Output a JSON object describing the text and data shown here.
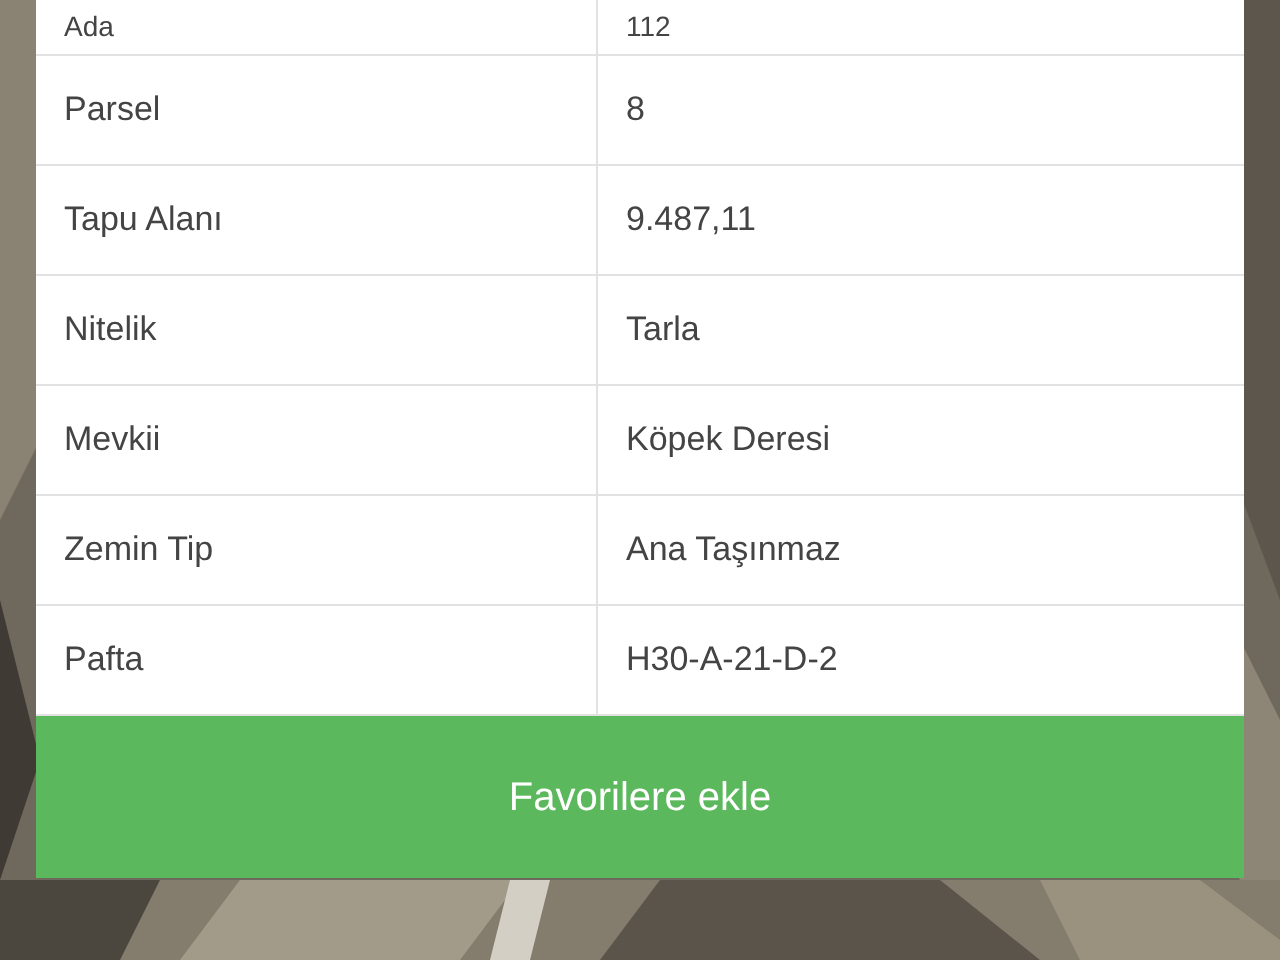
{
  "details": {
    "rows": [
      {
        "label": "Ada",
        "value": "112"
      },
      {
        "label": "Parsel",
        "value": "8"
      },
      {
        "label": "Tapu Alanı",
        "value": "9.487,11"
      },
      {
        "label": "Nitelik",
        "value": "Tarla"
      },
      {
        "label": "Mevkii",
        "value": "Köpek Deresi"
      },
      {
        "label": "Zemin Tip",
        "value": "Ana Taşınmaz"
      },
      {
        "label": "Pafta",
        "value": "H30-A-21-D-2"
      }
    ]
  },
  "button": {
    "label": "Favorilere ekle"
  }
}
